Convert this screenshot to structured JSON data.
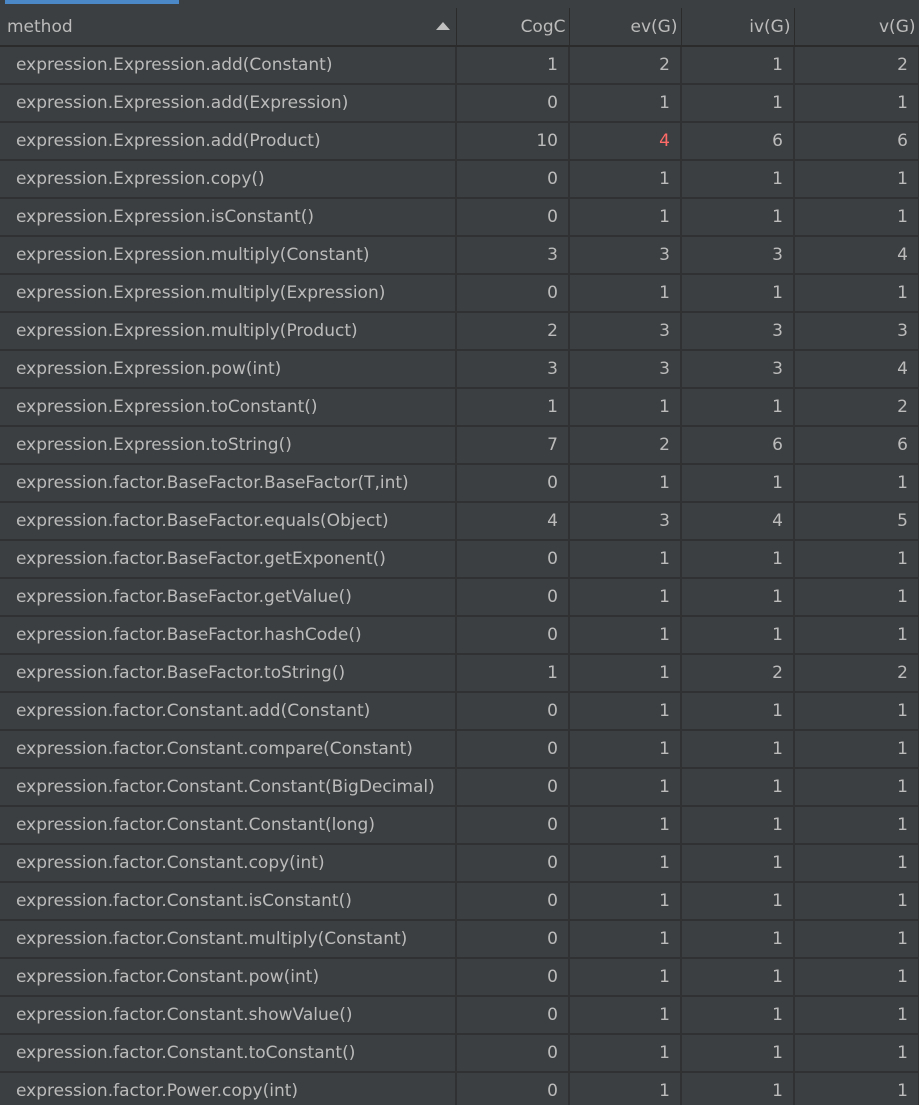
{
  "table": {
    "columns": [
      "method",
      "CogC",
      "ev(G)",
      "iv(G)",
      "v(G)"
    ],
    "sort": "ascending",
    "rows": [
      {
        "method": "expression.Expression.add(Constant)",
        "cogc": "1",
        "ev": "2",
        "iv": "1",
        "v": "2"
      },
      {
        "method": "expression.Expression.add(Expression)",
        "cogc": "0",
        "ev": "1",
        "iv": "1",
        "v": "1"
      },
      {
        "method": "expression.Expression.add(Product)",
        "cogc": "10",
        "ev": "4",
        "iv": "6",
        "v": "6",
        "highlight_ev": true
      },
      {
        "method": "expression.Expression.copy()",
        "cogc": "0",
        "ev": "1",
        "iv": "1",
        "v": "1"
      },
      {
        "method": "expression.Expression.isConstant()",
        "cogc": "0",
        "ev": "1",
        "iv": "1",
        "v": "1"
      },
      {
        "method": "expression.Expression.multiply(Constant)",
        "cogc": "3",
        "ev": "3",
        "iv": "3",
        "v": "4"
      },
      {
        "method": "expression.Expression.multiply(Expression)",
        "cogc": "0",
        "ev": "1",
        "iv": "1",
        "v": "1"
      },
      {
        "method": "expression.Expression.multiply(Product)",
        "cogc": "2",
        "ev": "3",
        "iv": "3",
        "v": "3"
      },
      {
        "method": "expression.Expression.pow(int)",
        "cogc": "3",
        "ev": "3",
        "iv": "3",
        "v": "4"
      },
      {
        "method": "expression.Expression.toConstant()",
        "cogc": "1",
        "ev": "1",
        "iv": "1",
        "v": "2"
      },
      {
        "method": "expression.Expression.toString()",
        "cogc": "7",
        "ev": "2",
        "iv": "6",
        "v": "6"
      },
      {
        "method": "expression.factor.BaseFactor.BaseFactor(T,int)",
        "cogc": "0",
        "ev": "1",
        "iv": "1",
        "v": "1"
      },
      {
        "method": "expression.factor.BaseFactor.equals(Object)",
        "cogc": "4",
        "ev": "3",
        "iv": "4",
        "v": "5"
      },
      {
        "method": "expression.factor.BaseFactor.getExponent()",
        "cogc": "0",
        "ev": "1",
        "iv": "1",
        "v": "1"
      },
      {
        "method": "expression.factor.BaseFactor.getValue()",
        "cogc": "0",
        "ev": "1",
        "iv": "1",
        "v": "1"
      },
      {
        "method": "expression.factor.BaseFactor.hashCode()",
        "cogc": "0",
        "ev": "1",
        "iv": "1",
        "v": "1"
      },
      {
        "method": "expression.factor.BaseFactor.toString()",
        "cogc": "1",
        "ev": "1",
        "iv": "2",
        "v": "2"
      },
      {
        "method": "expression.factor.Constant.add(Constant)",
        "cogc": "0",
        "ev": "1",
        "iv": "1",
        "v": "1"
      },
      {
        "method": "expression.factor.Constant.compare(Constant)",
        "cogc": "0",
        "ev": "1",
        "iv": "1",
        "v": "1"
      },
      {
        "method": "expression.factor.Constant.Constant(BigDecimal)",
        "cogc": "0",
        "ev": "1",
        "iv": "1",
        "v": "1"
      },
      {
        "method": "expression.factor.Constant.Constant(long)",
        "cogc": "0",
        "ev": "1",
        "iv": "1",
        "v": "1"
      },
      {
        "method": "expression.factor.Constant.copy(int)",
        "cogc": "0",
        "ev": "1",
        "iv": "1",
        "v": "1"
      },
      {
        "method": "expression.factor.Constant.isConstant()",
        "cogc": "0",
        "ev": "1",
        "iv": "1",
        "v": "1"
      },
      {
        "method": "expression.factor.Constant.multiply(Constant)",
        "cogc": "0",
        "ev": "1",
        "iv": "1",
        "v": "1"
      },
      {
        "method": "expression.factor.Constant.pow(int)",
        "cogc": "0",
        "ev": "1",
        "iv": "1",
        "v": "1"
      },
      {
        "method": "expression.factor.Constant.showValue()",
        "cogc": "0",
        "ev": "1",
        "iv": "1",
        "v": "1"
      },
      {
        "method": "expression.factor.Constant.toConstant()",
        "cogc": "0",
        "ev": "1",
        "iv": "1",
        "v": "1"
      },
      {
        "method": "expression.factor.Power.copy(int)",
        "cogc": "0",
        "ev": "1",
        "iv": "1",
        "v": "1"
      }
    ]
  },
  "colors": {
    "background": "#3c3f41",
    "grid": "#2f3133",
    "text": "#bbbbbb",
    "warning": "#ff6b68",
    "tab_indicator": "#4a88c7"
  }
}
